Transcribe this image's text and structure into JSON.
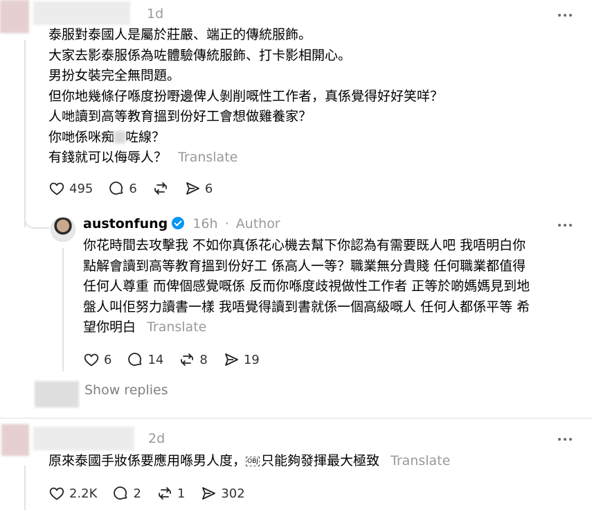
{
  "comments": [
    {
      "time": "1d",
      "lines": [
        "泰服對泰國人是屬於莊嚴、端正的傳統服飾。",
        "大家去影泰服係為咗體驗傳統服飾、打卡影相開心。",
        "男扮女裝完全無問題。",
        "但你地幾條仔喺度扮嘢邊俾人剝削嘅性工作者，真係覺得好好笑咩？",
        "人哋讀到高等教育搵到份好工會想做雞養家？",
        "你哋係咪痴",
        "咗線？",
        "有錢就可以侮辱人？"
      ],
      "translate": "Translate",
      "likes": "495",
      "replies": "6",
      "reposts": "",
      "shares": "6"
    },
    {
      "username": "austonfung",
      "time": "16h",
      "separator": "·",
      "author_tag": "Author",
      "lines": [
        "你花時間去攻擊我 不如你真係花心機去幫下你認為有需要既人吧 我唔明白你",
        "點解會讀到高等教育搵到份好工 係高人一等？職業無分貴賤 任何職業都值得",
        "任何人尊重 而俾個感覺嘅係 反而你喺度歧視做性工作者 正等於啲媽媽見到地",
        "盤人叫佢努力讀書一樣 我唔覺得讀到書就係一個高級嘅人 任何人都係平等 希",
        "望你明白"
      ],
      "translate": "Translate",
      "likes": "6",
      "replies": "14",
      "reposts": "8",
      "shares": "19"
    },
    {
      "time": "2d",
      "line": "原來泰國手妝係要應用喺男人度，",
      "line_symbol": "OBJ",
      "line_tail": "只能夠發揮最大極致",
      "translate": "Translate",
      "likes": "2.2K",
      "replies": "2",
      "reposts": "1",
      "shares": "302"
    }
  ],
  "show_replies": "Show replies",
  "colors": {
    "meta": "#999999",
    "verified": "#0095f6",
    "divider": "#e0e0e0"
  },
  "icons": [
    "heart-icon",
    "comment-icon",
    "repost-icon",
    "share-icon",
    "more-icon",
    "verified-icon"
  ]
}
